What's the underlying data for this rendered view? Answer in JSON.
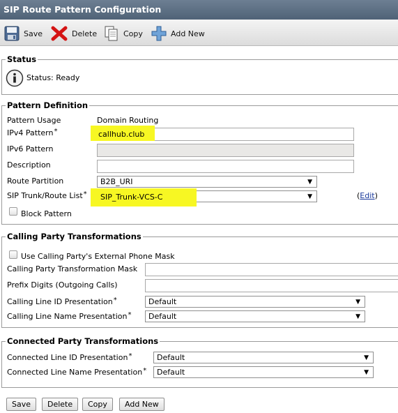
{
  "title": "SIP Route Pattern Configuration",
  "toolbar": {
    "save": "Save",
    "delete": "Delete",
    "copy": "Copy",
    "add_new": "Add New"
  },
  "status": {
    "legend": "Status",
    "text": "Status: Ready",
    "icon": "info-icon"
  },
  "pattern_definition": {
    "legend": "Pattern Definition",
    "pattern_usage_label": "Pattern Usage",
    "pattern_usage_value": "Domain Routing",
    "ipv4_label": "IPv4 Pattern",
    "ipv4_value": "callhub.club",
    "ipv6_label": "IPv6 Pattern",
    "ipv6_value": "",
    "description_label": "Description",
    "description_value": "",
    "route_partition_label": "Route Partition",
    "route_partition_value": "B2B_URI",
    "sip_trunk_label": "SIP Trunk/Route List",
    "sip_trunk_value": "SIP_Trunk-VCS-C",
    "edit_link": "Edit",
    "block_pattern_label": "Block Pattern",
    "block_pattern_checked": false,
    "highlight_color": "#f7f723"
  },
  "calling_party": {
    "legend": "Calling Party Transformations",
    "use_mask_label": "Use Calling Party's External Phone Mask",
    "use_mask_checked": false,
    "mask_label": "Calling Party Transformation Mask",
    "mask_value": "",
    "prefix_label": "Prefix Digits (Outgoing Calls)",
    "prefix_value": "",
    "line_id_label": "Calling Line ID Presentation",
    "line_id_value": "Default",
    "line_name_label": "Calling Line Name Presentation",
    "line_name_value": "Default"
  },
  "connected_party": {
    "legend": "Connected Party Transformations",
    "line_id_label": "Connected Line ID Presentation",
    "line_id_value": "Default",
    "line_name_label": "Connected Line Name Presentation",
    "line_name_value": "Default"
  },
  "bottom_buttons": {
    "save": "Save",
    "delete": "Delete",
    "copy": "Copy",
    "add_new": "Add New"
  }
}
